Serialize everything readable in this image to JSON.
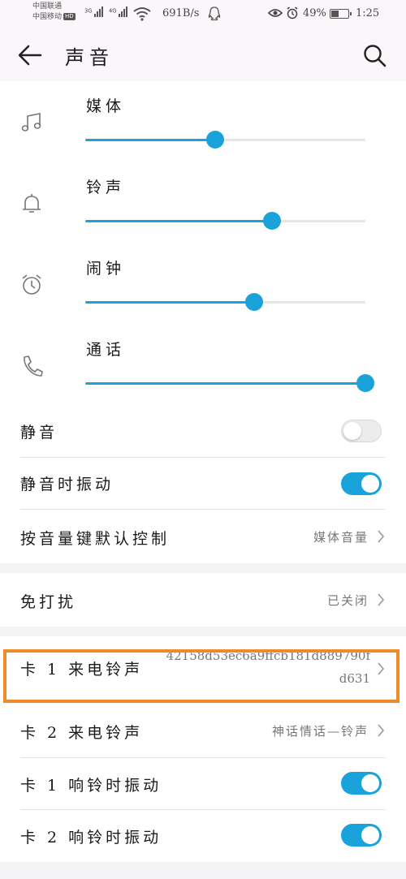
{
  "status_bar": {
    "carrier1": "中国联通",
    "carrier2": "中国移动",
    "hd": "HD",
    "sig1": "3G",
    "sig2": "4G",
    "net_speed": "691B/s",
    "battery": "49%",
    "battery_level": 0.49,
    "time": "1:25"
  },
  "header": {
    "title": "声音"
  },
  "volumes": [
    {
      "label": "媒体",
      "icon": "music-note-icon",
      "level": 0.465
    },
    {
      "label": "铃声",
      "icon": "bell-icon",
      "level": 0.667
    },
    {
      "label": "闹钟",
      "icon": "alarm-clock-icon",
      "level": 0.603
    },
    {
      "label": "通话",
      "icon": "phone-icon",
      "level": 1.0
    }
  ],
  "settings": {
    "mute": {
      "label": "静音",
      "on": false
    },
    "mute_vibrate": {
      "label": "静音时振动",
      "on": true
    },
    "volume_key": {
      "label": "按音量键默认控制",
      "value": "媒体音量"
    },
    "dnd": {
      "label": "免打扰",
      "value": "已关闭"
    },
    "sim1_ringtone": {
      "label": "卡 1 来电铃声",
      "value_line1": "42158d53ec6a9ffcb181d889790f",
      "value_line2": "d631"
    },
    "sim2_ringtone": {
      "label": "卡 2 来电铃声",
      "value": "神话情话—铃声"
    },
    "sim1_vibrate": {
      "label": "卡 1 响铃时振动",
      "on": true
    },
    "sim2_vibrate": {
      "label": "卡 2 响铃时振动",
      "on": true
    }
  },
  "colors": {
    "accent": "#1aa2db",
    "highlight": "#f0882c"
  }
}
